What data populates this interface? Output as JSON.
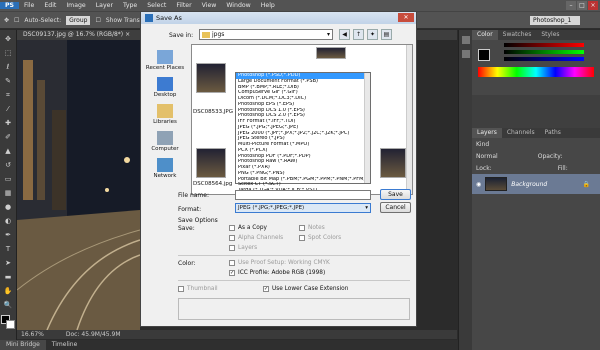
{
  "menu": {
    "items": [
      "PS",
      "File",
      "Edit",
      "Image",
      "Layer",
      "Type",
      "Select",
      "Filter",
      "View",
      "Window",
      "Help"
    ]
  },
  "options": {
    "auto_select": "Auto-Select:",
    "group": "Group",
    "show_trans": "Show Trans",
    "workspace": "Photoshop_1"
  },
  "document": {
    "tab": "DSC09137.jpg @ 16.7% (RGB/8*)",
    "zoom": "16.67%",
    "doc_size": "Doc: 45.9M/45.9M"
  },
  "bottom_tabs": [
    "Mini Bridge",
    "Timeline"
  ],
  "panels": {
    "color_tabs": [
      "Color",
      "Swatches",
      "Styles"
    ],
    "layers_tabs": [
      "Layers",
      "Channels",
      "Paths"
    ],
    "kind": "Kind",
    "mode": "Normal",
    "opacity": "Opacity:",
    "lock": "Lock:",
    "fill": "Fill:",
    "layer_name": "Background"
  },
  "dialog": {
    "title": "Save As",
    "save_in_label": "Save in:",
    "save_in_value": "jpgs",
    "places": [
      "Recent Places",
      "Desktop",
      "Libraries",
      "Computer",
      "Network"
    ],
    "files": [
      "DSC08533.JPG",
      "DSC08564.jpg"
    ],
    "file_name_label": "File name:",
    "format_label": "Format:",
    "format_value": "JPEG (*.JPG;*.JPEG;*.JPE)",
    "save_button": "Save",
    "cancel_button": "Cancel",
    "format_options": [
      "Photoshop (*.PSD;*.PDD)",
      "Large Document Format (*.PSB)",
      "BMP (*.BMP;*.RLE;*.DIB)",
      "CompuServe GIF (*.GIF)",
      "Dicom (*.DCM;*.DC3;*.DIC)",
      "Photoshop EPS (*.EPS)",
      "Photoshop DCS 1.0 (*.EPS)",
      "Photoshop DCS 2.0 (*.EPS)",
      "IFF Format (*.IFF;*.TDI)",
      "JPEG (*.JPG;*.JPEG;*.JPE)",
      "JPEG 2000 (*.JPF;*.JPX;*.JP2;*.J2C;*.J2K;*.JPC)",
      "JPEG Stereo (*.JPS)",
      "Multi-Picture Format (*.MPO)",
      "PCX (*.PCX)",
      "Photoshop PDF (*.PDF;*.PDP)",
      "Photoshop Raw (*.RAW)",
      "Pixar (*.PXR)",
      "PNG (*.PNG;*.PNS)",
      "Portable Bit Map (*.PBM;*.PGM;*.PPM;*.PNM;*.PFM;*.PAM)",
      "Scitex CT (*.SCT)",
      "Targa (*.TGA;*.VDA;*.ICB;*.VST)",
      "TIFF (*.TIF;*.TIFF)"
    ],
    "save_options_title": "Save Options",
    "save_label": "Save:",
    "as_copy": "As a Copy",
    "notes": "Notes",
    "alpha": "Alpha Channels",
    "spot": "Spot Colors",
    "layers": "Layers",
    "color_label": "Color:",
    "proof": "Use Proof Setup:  Working CMYK",
    "icc": "ICC Profile:  Adobe RGB (1998)",
    "thumbnail": "Thumbnail",
    "lowercase": "Use Lower Case Extension"
  }
}
